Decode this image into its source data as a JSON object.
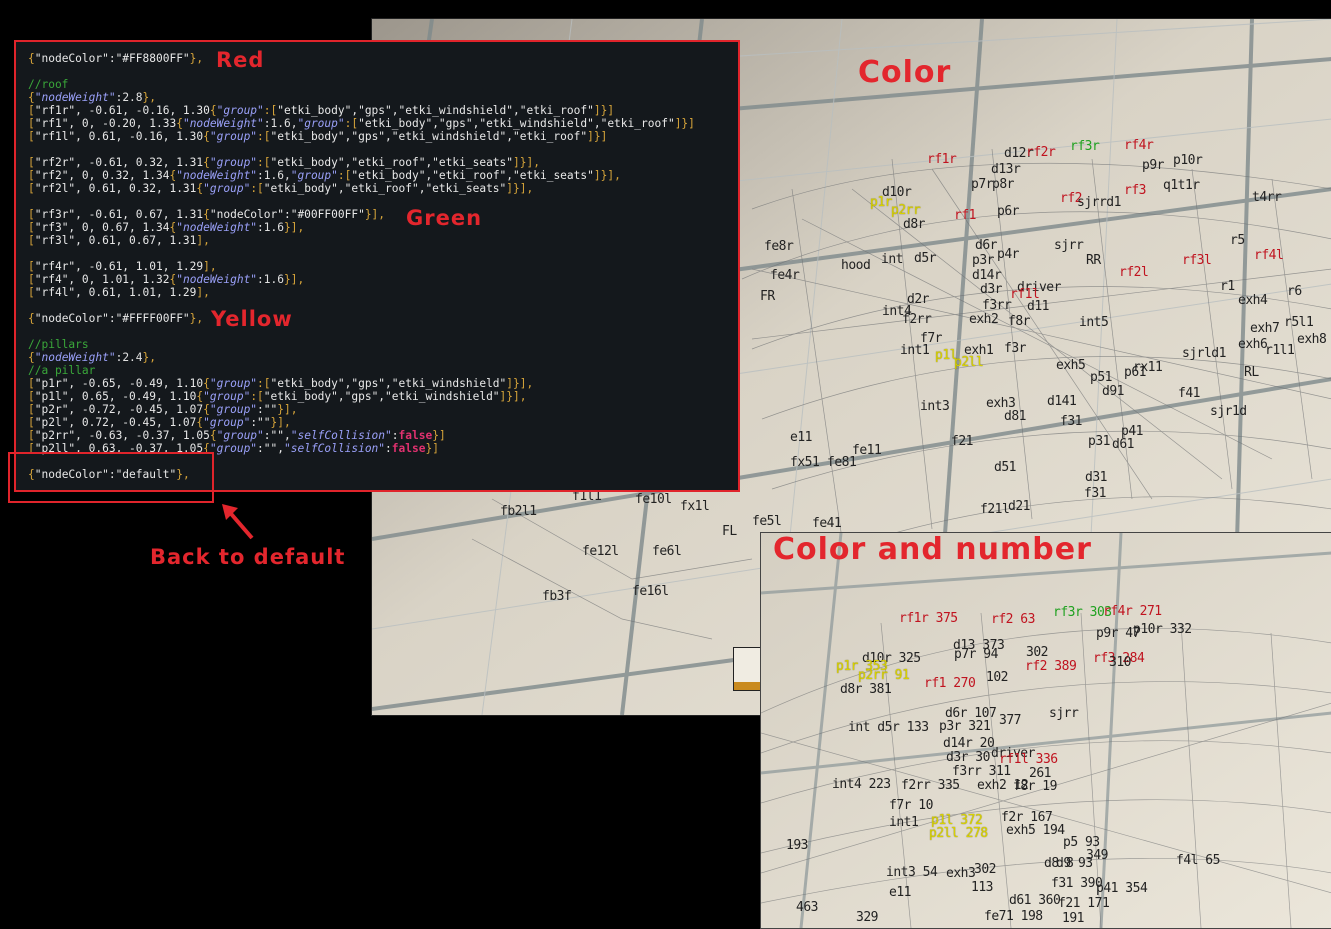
{
  "editor": {
    "lines": [
      [
        {
          "t": "{",
          "c": "br"
        },
        {
          "t": "\"nodeColor\":\"#FF8800FF\"",
          "c": "str"
        },
        {
          "t": "},",
          "c": "br"
        }
      ],
      [],
      [
        {
          "t": "//roof",
          "c": "cm"
        }
      ],
      [
        {
          "t": "{",
          "c": "br"
        },
        {
          "t": "\"nodeWeight\"",
          "c": "key"
        },
        {
          "t": ":2.8",
          "c": "num"
        },
        {
          "t": "},",
          "c": "br"
        }
      ],
      [
        {
          "t": "[",
          "c": "br"
        },
        {
          "t": "\"rf1r\", -0.61, -0.16, 1.30",
          "c": "str"
        },
        {
          "t": "{",
          "c": "br"
        },
        {
          "t": "\"group\"",
          "c": "key"
        },
        {
          "t": ":[",
          "c": "br"
        },
        {
          "t": "\"etki_body\",\"gps\",\"etki_windshield\",\"etki_roof\"",
          "c": "str"
        },
        {
          "t": "]}]",
          "c": "br"
        }
      ],
      [
        {
          "t": "[",
          "c": "br"
        },
        {
          "t": "\"rf1\", 0, -0.20, 1.33",
          "c": "str"
        },
        {
          "t": "{",
          "c": "br"
        },
        {
          "t": "\"nodeWeight\"",
          "c": "key"
        },
        {
          "t": ":1.6,",
          "c": "num"
        },
        {
          "t": "\"group\"",
          "c": "key"
        },
        {
          "t": ":[",
          "c": "br"
        },
        {
          "t": "\"etki_body\",\"gps\",\"etki_windshield\",\"etki_roof\"",
          "c": "str"
        },
        {
          "t": "]}]",
          "c": "br"
        }
      ],
      [
        {
          "t": "[",
          "c": "br"
        },
        {
          "t": "\"rf1l\", 0.61, -0.16, 1.30",
          "c": "str"
        },
        {
          "t": "{",
          "c": "br"
        },
        {
          "t": "\"group\"",
          "c": "key"
        },
        {
          "t": ":[",
          "c": "br"
        },
        {
          "t": "\"etki_body\",\"gps\",\"etki_windshield\",\"etki_roof\"",
          "c": "str"
        },
        {
          "t": "]}]",
          "c": "br"
        }
      ],
      [],
      [
        {
          "t": "[",
          "c": "br"
        },
        {
          "t": "\"rf2r\", -0.61, 0.32, 1.31",
          "c": "str"
        },
        {
          "t": "{",
          "c": "br"
        },
        {
          "t": "\"group\"",
          "c": "key"
        },
        {
          "t": ":[",
          "c": "br"
        },
        {
          "t": "\"etki_body\",\"etki_roof\",\"etki_seats\"",
          "c": "str"
        },
        {
          "t": "]}],",
          "c": "br"
        }
      ],
      [
        {
          "t": "[",
          "c": "br"
        },
        {
          "t": "\"rf2\", 0, 0.32, 1.34",
          "c": "str"
        },
        {
          "t": "{",
          "c": "br"
        },
        {
          "t": "\"nodeWeight\"",
          "c": "key"
        },
        {
          "t": ":1.6,",
          "c": "num"
        },
        {
          "t": "\"group\"",
          "c": "key"
        },
        {
          "t": ":[",
          "c": "br"
        },
        {
          "t": "\"etki_body\",\"etki_roof\",\"etki_seats\"",
          "c": "str"
        },
        {
          "t": "]}],",
          "c": "br"
        }
      ],
      [
        {
          "t": "[",
          "c": "br"
        },
        {
          "t": "\"rf2l\", 0.61, 0.32, 1.31",
          "c": "str"
        },
        {
          "t": "{",
          "c": "br"
        },
        {
          "t": "\"group\"",
          "c": "key"
        },
        {
          "t": ":[",
          "c": "br"
        },
        {
          "t": "\"etki_body\",\"etki_roof\",\"etki_seats\"",
          "c": "str"
        },
        {
          "t": "]}],",
          "c": "br"
        }
      ],
      [],
      [
        {
          "t": "[",
          "c": "br"
        },
        {
          "t": "\"rf3r\", -0.61, 0.67, 1.31",
          "c": "str"
        },
        {
          "t": "{",
          "c": "br"
        },
        {
          "t": "\"nodeColor\":\"#00FF00FF\"",
          "c": "str"
        },
        {
          "t": "}],",
          "c": "br"
        }
      ],
      [
        {
          "t": "[",
          "c": "br"
        },
        {
          "t": "\"rf3\", 0, 0.67, 1.34",
          "c": "str"
        },
        {
          "t": "{",
          "c": "br"
        },
        {
          "t": "\"nodeWeight\"",
          "c": "key"
        },
        {
          "t": ":1.6",
          "c": "num"
        },
        {
          "t": "}],",
          "c": "br"
        }
      ],
      [
        {
          "t": "[",
          "c": "br"
        },
        {
          "t": "\"rf3l\", 0.61, 0.67, 1.31",
          "c": "str"
        },
        {
          "t": "],",
          "c": "br"
        }
      ],
      [],
      [
        {
          "t": "[",
          "c": "br"
        },
        {
          "t": "\"rf4r\", -0.61, 1.01, 1.29",
          "c": "str"
        },
        {
          "t": "],",
          "c": "br"
        }
      ],
      [
        {
          "t": "[",
          "c": "br"
        },
        {
          "t": "\"rf4\", 0, 1.01, 1.32",
          "c": "str"
        },
        {
          "t": "{",
          "c": "br"
        },
        {
          "t": "\"nodeWeight\"",
          "c": "key"
        },
        {
          "t": ":1.6",
          "c": "num"
        },
        {
          "t": "}],",
          "c": "br"
        }
      ],
      [
        {
          "t": "[",
          "c": "br"
        },
        {
          "t": "\"rf4l\", 0.61, 1.01, 1.29",
          "c": "str"
        },
        {
          "t": "],",
          "c": "br"
        }
      ],
      [],
      [
        {
          "t": "{",
          "c": "br"
        },
        {
          "t": "\"nodeColor\":\"#FFFF00FF\"",
          "c": "str"
        },
        {
          "t": "},",
          "c": "br"
        }
      ],
      [],
      [
        {
          "t": "//pillars",
          "c": "cm"
        }
      ],
      [
        {
          "t": "{",
          "c": "br"
        },
        {
          "t": "\"nodeWeight\"",
          "c": "key"
        },
        {
          "t": ":2.4",
          "c": "num"
        },
        {
          "t": "},",
          "c": "br"
        }
      ],
      [
        {
          "t": "//a pillar",
          "c": "cm"
        }
      ],
      [
        {
          "t": "[",
          "c": "br"
        },
        {
          "t": "\"p1r\", -0.65, -0.49, 1.10",
          "c": "str"
        },
        {
          "t": "{",
          "c": "br"
        },
        {
          "t": "\"group\"",
          "c": "key"
        },
        {
          "t": ":[",
          "c": "br"
        },
        {
          "t": "\"etki_body\",\"gps\",\"etki_windshield\"",
          "c": "str"
        },
        {
          "t": "]}],",
          "c": "br"
        }
      ],
      [
        {
          "t": "[",
          "c": "br"
        },
        {
          "t": "\"p1l\", 0.65, -0.49, 1.10",
          "c": "str"
        },
        {
          "t": "{",
          "c": "br"
        },
        {
          "t": "\"group\"",
          "c": "key"
        },
        {
          "t": ":[",
          "c": "br"
        },
        {
          "t": "\"etki_body\",\"gps\",\"etki_windshield\"",
          "c": "str"
        },
        {
          "t": "]}],",
          "c": "br"
        }
      ],
      [
        {
          "t": "[",
          "c": "br"
        },
        {
          "t": "\"p2r\", -0.72, -0.45, 1.07",
          "c": "str"
        },
        {
          "t": "{",
          "c": "br"
        },
        {
          "t": "\"group\"",
          "c": "key"
        },
        {
          "t": ":\"\"",
          "c": "str"
        },
        {
          "t": "}],",
          "c": "br"
        }
      ],
      [
        {
          "t": "[",
          "c": "br"
        },
        {
          "t": "\"p2l\", 0.72, -0.45, 1.07",
          "c": "str"
        },
        {
          "t": "{",
          "c": "br"
        },
        {
          "t": "\"group\"",
          "c": "key"
        },
        {
          "t": ":\"\"",
          "c": "str"
        },
        {
          "t": "}],",
          "c": "br"
        }
      ],
      [
        {
          "t": "[",
          "c": "br"
        },
        {
          "t": "\"p2rr\", -0.63, -0.37, 1.05",
          "c": "str"
        },
        {
          "t": "{",
          "c": "br"
        },
        {
          "t": "\"group\"",
          "c": "key"
        },
        {
          "t": ":\"\",",
          "c": "str"
        },
        {
          "t": "\"selfCollision\"",
          "c": "key"
        },
        {
          "t": ":",
          "c": "str"
        },
        {
          "t": "false",
          "c": "bool"
        },
        {
          "t": "}]",
          "c": "br"
        }
      ],
      [
        {
          "t": "[",
          "c": "br"
        },
        {
          "t": "\"p2ll\", 0.63, -0.37, 1.05",
          "c": "str"
        },
        {
          "t": "{",
          "c": "br"
        },
        {
          "t": "\"group\"",
          "c": "key"
        },
        {
          "t": ":\"\",",
          "c": "str"
        },
        {
          "t": "\"selfCollision\"",
          "c": "key"
        },
        {
          "t": ":",
          "c": "str"
        },
        {
          "t": "false",
          "c": "bool"
        },
        {
          "t": "}]",
          "c": "br"
        }
      ],
      [],
      [
        {
          "t": "{",
          "c": "br"
        },
        {
          "t": "\"nodeColor\":\"default\"",
          "c": "str"
        },
        {
          "t": "},",
          "c": "br"
        }
      ]
    ]
  },
  "annotations": {
    "red": "Red",
    "green": "Green",
    "yellow": "Yellow",
    "color": "Color",
    "color_and_number": "Color and number",
    "back_to_default": "Back to default"
  },
  "colors": {
    "annotation": "#e3262d",
    "node_red": "#c0131f",
    "node_green": "#1fa11f",
    "node_yellow": "#d8d200",
    "editor_bg": "#14181c"
  },
  "viewport_top": {
    "nodes": [
      {
        "t": "rf1r",
        "c": "red"
      },
      {
        "t": "d12r",
        "c": ""
      },
      {
        "t": "rf2r",
        "c": "red"
      },
      {
        "t": "rf3r",
        "c": "green"
      },
      {
        "t": "rf4r",
        "c": "red"
      },
      {
        "t": "p10r",
        "c": ""
      },
      {
        "t": "p9r",
        "c": ""
      },
      {
        "t": "d13r",
        "c": ""
      },
      {
        "t": "p7r",
        "c": ""
      },
      {
        "t": "p8r",
        "c": ""
      },
      {
        "t": "rf2",
        "c": "red"
      },
      {
        "t": "sjrrd1",
        "c": ""
      },
      {
        "t": "rf3",
        "c": "red"
      },
      {
        "t": "q1t1r",
        "c": ""
      },
      {
        "t": "t4rr",
        "c": ""
      },
      {
        "t": "d10r",
        "c": ""
      },
      {
        "t": "p1r",
        "c": "yellow"
      },
      {
        "t": "p2rr",
        "c": "yellow"
      },
      {
        "t": "rf1",
        "c": "red"
      },
      {
        "t": "p6r",
        "c": ""
      },
      {
        "t": "d8r",
        "c": ""
      },
      {
        "t": "fe8r",
        "c": ""
      },
      {
        "t": "hood",
        "c": ""
      },
      {
        "t": "int",
        "c": ""
      },
      {
        "t": "d5r",
        "c": ""
      },
      {
        "t": "d6r",
        "c": ""
      },
      {
        "t": "p4r",
        "c": ""
      },
      {
        "t": "p3r",
        "c": ""
      },
      {
        "t": "sjrr",
        "c": ""
      },
      {
        "t": "RR",
        "c": ""
      },
      {
        "t": "rf2l",
        "c": "red"
      },
      {
        "t": "rf3l",
        "c": "red"
      },
      {
        "t": "rf4l",
        "c": "red"
      },
      {
        "t": "fe4r",
        "c": ""
      },
      {
        "t": "d14r",
        "c": ""
      },
      {
        "t": "d3r",
        "c": ""
      },
      {
        "t": "driver",
        "c": ""
      },
      {
        "t": "rf1l",
        "c": "red"
      },
      {
        "t": "FR",
        "c": ""
      },
      {
        "t": "d2r",
        "c": ""
      },
      {
        "t": "d11",
        "c": ""
      },
      {
        "t": "f3rr",
        "c": ""
      },
      {
        "t": "int4",
        "c": ""
      },
      {
        "t": "f2rr",
        "c": ""
      },
      {
        "t": "exh2",
        "c": ""
      },
      {
        "t": "f8r",
        "c": ""
      },
      {
        "t": "exh4",
        "c": ""
      },
      {
        "t": "r1",
        "c": ""
      },
      {
        "t": "r5",
        "c": ""
      },
      {
        "t": "r6",
        "c": ""
      },
      {
        "t": "r5l1",
        "c": ""
      },
      {
        "t": "f7r",
        "c": ""
      },
      {
        "t": "int5",
        "c": ""
      },
      {
        "t": "exh7",
        "c": ""
      },
      {
        "t": "exh6",
        "c": ""
      },
      {
        "t": "int1",
        "c": ""
      },
      {
        "t": "p1l",
        "c": "yellow"
      },
      {
        "t": "p2ll",
        "c": "yellow"
      },
      {
        "t": "exh1",
        "c": ""
      },
      {
        "t": "f3r",
        "c": ""
      },
      {
        "t": "exh5",
        "c": ""
      },
      {
        "t": "rx11",
        "c": ""
      },
      {
        "t": "sjrld1",
        "c": ""
      },
      {
        "t": "r1l1",
        "c": ""
      },
      {
        "t": "exh8",
        "c": ""
      },
      {
        "t": "p51",
        "c": ""
      },
      {
        "t": "p61",
        "c": ""
      },
      {
        "t": "RL",
        "c": ""
      },
      {
        "t": "int3",
        "c": ""
      },
      {
        "t": "exh3",
        "c": ""
      },
      {
        "t": "d81",
        "c": ""
      },
      {
        "t": "d141",
        "c": ""
      },
      {
        "t": "d91",
        "c": ""
      },
      {
        "t": "f41",
        "c": ""
      },
      {
        "t": "f31",
        "c": ""
      },
      {
        "t": "sjr1d",
        "c": ""
      },
      {
        "t": "f21",
        "c": ""
      },
      {
        "t": "p31",
        "c": ""
      },
      {
        "t": "p41",
        "c": ""
      },
      {
        "t": "d61",
        "c": ""
      },
      {
        "t": "d51",
        "c": ""
      },
      {
        "t": "d31",
        "c": ""
      },
      {
        "t": "f31",
        "c": ""
      },
      {
        "t": "d21",
        "c": ""
      },
      {
        "t": "f21l",
        "c": ""
      },
      {
        "t": "fx51",
        "c": ""
      },
      {
        "t": "fe81",
        "c": ""
      },
      {
        "t": "e11",
        "c": ""
      },
      {
        "t": "fe11",
        "c": ""
      },
      {
        "t": "fe41",
        "c": ""
      },
      {
        "t": "fb2l1",
        "c": ""
      },
      {
        "t": "f1l1",
        "c": ""
      },
      {
        "t": "fe10l",
        "c": ""
      },
      {
        "t": "fx1l",
        "c": ""
      },
      {
        "t": "FL",
        "c": ""
      },
      {
        "t": "fe12l",
        "c": ""
      },
      {
        "t": "fe6l",
        "c": ""
      },
      {
        "t": "fe16l",
        "c": ""
      },
      {
        "t": "fb3f",
        "c": ""
      },
      {
        "t": "fe5l",
        "c": ""
      }
    ]
  },
  "viewport_bottom": {
    "nodes": [
      {
        "t": "rf1r 375",
        "c": "red"
      },
      {
        "t": "rf2 63",
        "c": "red"
      },
      {
        "t": "rf3r 303",
        "c": "green"
      },
      {
        "t": "rf4r 271",
        "c": "red"
      },
      {
        "t": "p9r 47",
        "c": ""
      },
      {
        "t": "p10r 332",
        "c": ""
      },
      {
        "t": "d10r 325",
        "c": ""
      },
      {
        "t": "d13 373",
        "c": ""
      },
      {
        "t": "p7r 94",
        "c": ""
      },
      {
        "t": "302",
        "c": ""
      },
      {
        "t": "p1r 353",
        "c": "yellow"
      },
      {
        "t": "p2rr 91",
        "c": "yellow"
      },
      {
        "t": "rf2 389",
        "c": "red"
      },
      {
        "t": "rf3 284",
        "c": "red"
      },
      {
        "t": "310",
        "c": ""
      },
      {
        "t": "d8r 381",
        "c": ""
      },
      {
        "t": "rf1 270",
        "c": "red"
      },
      {
        "t": "102",
        "c": ""
      },
      {
        "t": "d6r 107",
        "c": ""
      },
      {
        "t": "377",
        "c": ""
      },
      {
        "t": "sjrr",
        "c": ""
      },
      {
        "t": "int d5r 133",
        "c": ""
      },
      {
        "t": "p3r 321",
        "c": ""
      },
      {
        "t": "d14r 20",
        "c": ""
      },
      {
        "t": "d3r 30",
        "c": ""
      },
      {
        "t": "driver",
        "c": ""
      },
      {
        "t": "rf1l 336",
        "c": "red"
      },
      {
        "t": "f3rr 311",
        "c": ""
      },
      {
        "t": "261",
        "c": ""
      },
      {
        "t": "int4 223",
        "c": ""
      },
      {
        "t": "f2rr 335",
        "c": ""
      },
      {
        "t": "exh2 12",
        "c": ""
      },
      {
        "t": "f8r 19",
        "c": ""
      },
      {
        "t": "f7r 10",
        "c": ""
      },
      {
        "t": "int1",
        "c": ""
      },
      {
        "t": "p1l 372",
        "c": "yellow"
      },
      {
        "t": "p2ll 278",
        "c": "yellow"
      },
      {
        "t": "f2r 167",
        "c": ""
      },
      {
        "t": "exh5 194",
        "c": ""
      },
      {
        "t": "p5 93",
        "c": ""
      },
      {
        "t": "349",
        "c": ""
      },
      {
        "t": "d9 93",
        "c": ""
      },
      {
        "t": "f4l 65",
        "c": ""
      },
      {
        "t": "int3 54",
        "c": ""
      },
      {
        "t": "exh3",
        "c": ""
      },
      {
        "t": "302",
        "c": ""
      },
      {
        "t": "d8 8",
        "c": ""
      },
      {
        "t": "113",
        "c": ""
      },
      {
        "t": "f31 390",
        "c": ""
      },
      {
        "t": "p41 354",
        "c": ""
      },
      {
        "t": "d61 360",
        "c": ""
      },
      {
        "t": "f21 171",
        "c": ""
      },
      {
        "t": "191",
        "c": ""
      },
      {
        "t": "fe71 198",
        "c": ""
      },
      {
        "t": "e11",
        "c": ""
      },
      {
        "t": "329",
        "c": ""
      },
      {
        "t": "463",
        "c": ""
      },
      {
        "t": "193",
        "c": ""
      }
    ]
  }
}
